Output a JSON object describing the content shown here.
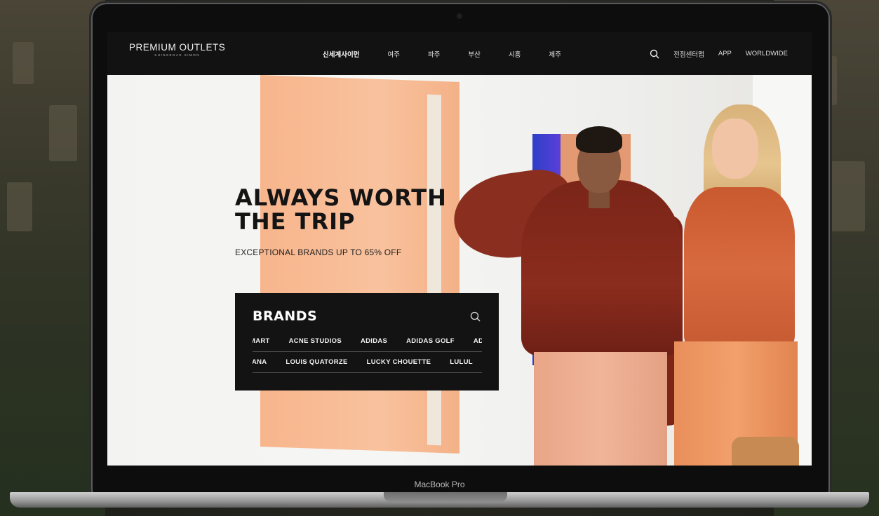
{
  "nav": {
    "logo_main": "PREMIUM OUTLETS",
    "logo_sub": "SHINSEGAE SIMON",
    "menu": [
      {
        "label": "신세계사이먼",
        "active": true
      },
      {
        "label": "여주"
      },
      {
        "label": "파주"
      },
      {
        "label": "부산"
      },
      {
        "label": "시흥"
      },
      {
        "label": "제주"
      }
    ],
    "utility": [
      "전점센터맵",
      "APP",
      "WORLDWIDE"
    ],
    "search_icon": "search-icon"
  },
  "hero": {
    "title_line1": "ALWAYS WORTH",
    "title_line2": "THE TRIP",
    "subtitle": "EXCEPTIONAL BRANDS UP TO 65% OFF"
  },
  "brands": {
    "title": "BRANDS",
    "row1": [
      "MART",
      "ACNE STUDIOS",
      "ADIDAS",
      "ADIDAS GOLF",
      "AD"
    ],
    "row2": [
      "IANA",
      "LOUIS QUATORZE",
      "LUCKY CHOUETTE",
      "LULUL"
    ]
  },
  "device": {
    "label": "MacBook Pro"
  },
  "colors": {
    "nav_bg": "#121212",
    "panel_bg": "#131313",
    "accent_orange": "#f7b58c"
  }
}
